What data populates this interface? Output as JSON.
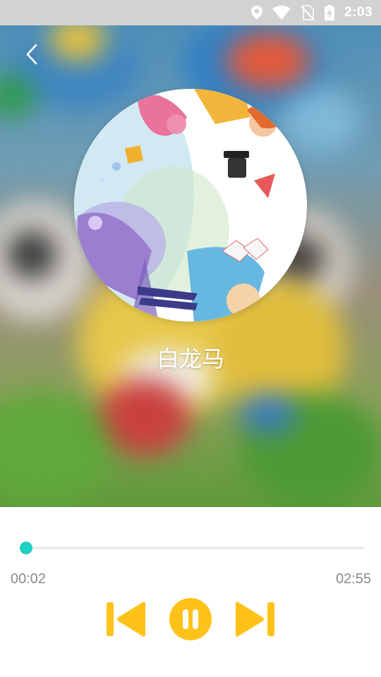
{
  "status_bar": {
    "time": "2:03",
    "icons": [
      "location-icon",
      "wifi-icon",
      "no-sim-icon",
      "battery-charging-icon"
    ]
  },
  "header": {
    "back_icon": "chevron-left-icon"
  },
  "now_playing": {
    "title": "白龙马",
    "album_art": "cartoon-children-album-art"
  },
  "player": {
    "elapsed": "00:02",
    "duration": "02:55",
    "progress_fraction": 0.011,
    "state": "playing",
    "accent_color": "#1ed0c0",
    "control_color": "#ffc21a",
    "controls": [
      "skip-previous-icon",
      "pause-icon",
      "skip-next-icon"
    ]
  }
}
